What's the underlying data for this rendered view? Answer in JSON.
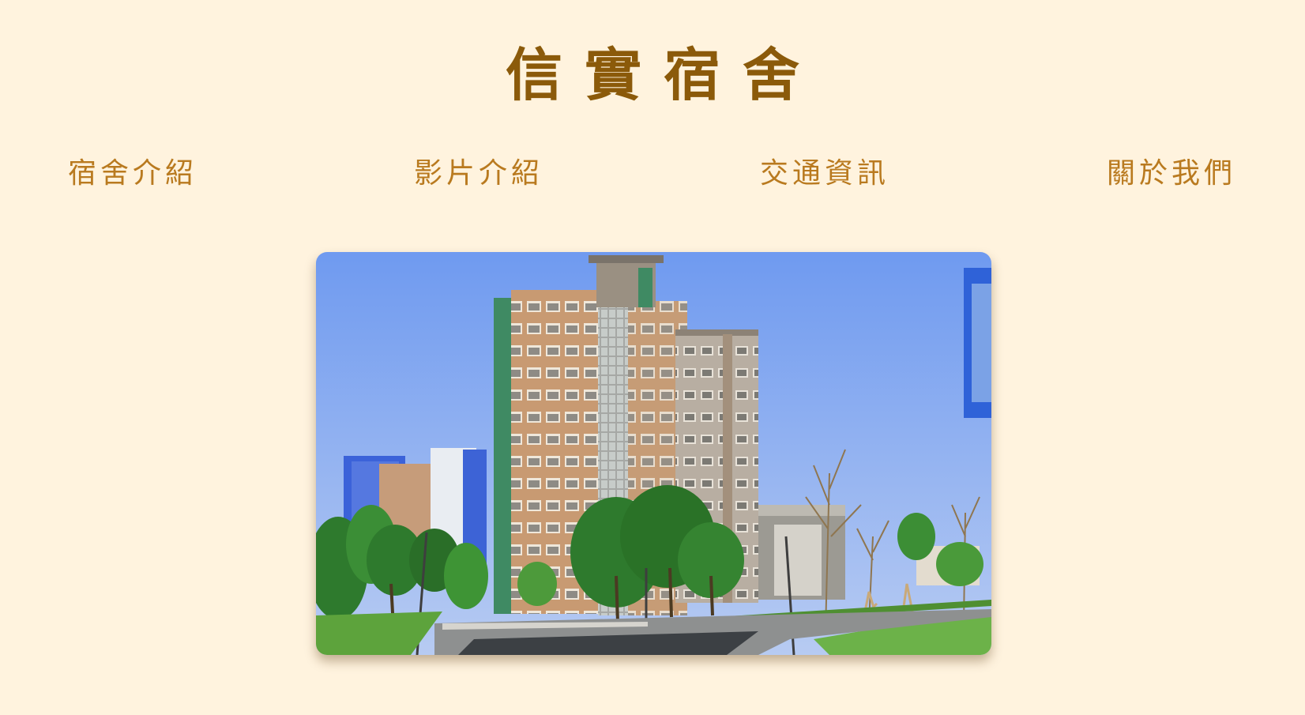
{
  "header": {
    "title": "信實宿舍"
  },
  "nav": {
    "items": [
      {
        "label": "宿舍介紹"
      },
      {
        "label": "影片介紹"
      },
      {
        "label": "交通資訊"
      },
      {
        "label": "關於我們"
      }
    ]
  },
  "photo": {
    "subject": "dormitory-building-photo"
  },
  "colors": {
    "background": "#FFF3DE",
    "title": "#8B5A0A",
    "nav_text": "#B97A1F"
  }
}
